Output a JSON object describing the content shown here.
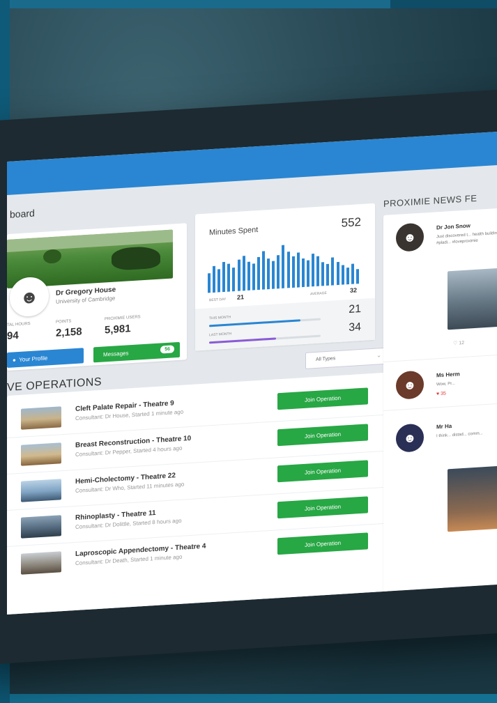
{
  "breadcrumb": "board",
  "profile": {
    "name": "Dr Gregory House",
    "university": "University of Cambridge",
    "stats": [
      {
        "label": "TAL HOURS",
        "value": "94"
      },
      {
        "label": "POINTS",
        "value": "2,158"
      },
      {
        "label": "PROXIMIE USERS",
        "value": "5,981"
      }
    ],
    "profile_button": "Your Profile",
    "messages_button": "Messages",
    "messages_count": "56"
  },
  "minutes": {
    "title": "Minutes Spent",
    "value": "552",
    "best_day_label": "BEST DAY",
    "best_day_value": "21",
    "average_label": "AVERAGE",
    "average_value": "32",
    "this_month_label": "THIS MONTH",
    "this_month_value": "21",
    "this_month_progress": 0.82,
    "last_month_label": "LAST MONTH",
    "last_month_value": "34",
    "last_month_progress": 0.6,
    "bar_values": [
      40,
      55,
      48,
      62,
      58,
      50,
      66,
      72,
      60,
      55,
      68,
      80,
      64,
      58,
      70,
      90,
      75,
      65,
      72,
      60,
      55,
      68,
      62,
      50,
      45,
      58,
      48,
      40,
      35,
      42,
      30
    ]
  },
  "operations": {
    "title": "VE OPERATIONS",
    "filter": "All Types",
    "items": [
      {
        "title": "Cleft Palate Repair - Theatre 9",
        "subtitle": "Consultant: Dr House, Started 1 minute ago",
        "button": "Join Operation"
      },
      {
        "title": "Breast Reconstruction - Theatre 10",
        "subtitle": "Consultant: Dr Pepper, Started 4 hours ago",
        "button": "Join Operation"
      },
      {
        "title": "Hemi-Cholectomy - Theatre 22",
        "subtitle": "Consultant: Dr Who, Started 11 minutes ago",
        "button": "Join Operation"
      },
      {
        "title": "Rhinoplasty - Theatre 11",
        "subtitle": "Consultant: Dr Dolittle, Started 8 hours ago",
        "button": "Join Operation"
      },
      {
        "title": "Laproscopic Appendectomy - Theatre 4",
        "subtitle": "Consultant: Dr Death, Started 1 minute ago",
        "button": "Join Operation"
      }
    ]
  },
  "news": {
    "title": "PROXIMIE NEWS FE",
    "items": [
      {
        "name": "Dr Jon Snow",
        "text": "Just discovered t... health buildings... Festival, #pladi... #loveproximie",
        "likes": "12"
      },
      {
        "name": "Ms Herm",
        "text": "Wow, Pr...",
        "likes": "35"
      },
      {
        "name": "Mr Ha",
        "text": "I think... distad... comm..."
      }
    ]
  },
  "colors": {
    "primary": "#2a86d2",
    "success": "#28a745",
    "accent_purple": "#8a5bd6",
    "like_red": "#e23b3b"
  }
}
